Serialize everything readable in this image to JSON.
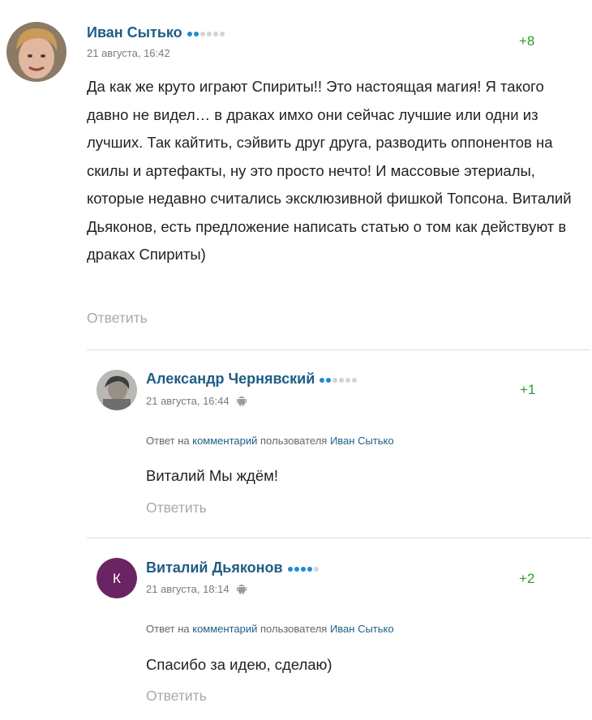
{
  "comments": [
    {
      "author": "Иван Сытько",
      "level": {
        "filled": 2,
        "total": 6
      },
      "date": "21 августа, 16:42",
      "rating": "+8",
      "text": "Да как же круто играют Спириты!! Это настоящая магия! Я такого давно не видел… в драках имхо они сейчас лучшие или одни из лучших. Так кайтить, сэйвить друг друга, разводить оппонентов на скилы и артефакты, ну это просто нечто! И массовые этериалы, которые недавно считались эксклюзивной фишкой Топсона. Виталий Дьяконов, есть предложение написать статью о том как действуют в драках Спириты)",
      "reply_label": "Ответить"
    },
    {
      "author": "Александр Чернявский",
      "level": {
        "filled": 2,
        "total": 6
      },
      "date": "21 августа, 16:44",
      "device_icon": "android-icon",
      "rating": "+1",
      "reply_to": {
        "prefix": "Ответ на",
        "link": "комментарий",
        "middle": "пользователя",
        "user": "Иван Сытько"
      },
      "text": "Виталий Мы ждём!",
      "reply_label": "Ответить"
    },
    {
      "author": "Виталий Дьяконов",
      "avatar_letter": "К",
      "avatar_color": "#6b2463",
      "level": {
        "filled": 4,
        "total": 5
      },
      "date": "21 августа, 18:14",
      "device_icon": "android-icon",
      "rating": "+2",
      "reply_to": {
        "prefix": "Ответ на",
        "link": "комментарий",
        "middle": "пользователя",
        "user": "Иван Сытько"
      },
      "text": "Спасибо за идею, сделаю)",
      "reply_label": "Ответить"
    }
  ],
  "colors": {
    "author": "#1f5d85",
    "rating": "#2f9a2f",
    "muted": "#a8a8a8",
    "level_on": "#1f8bd1",
    "level_off": "#d3d3d3"
  }
}
